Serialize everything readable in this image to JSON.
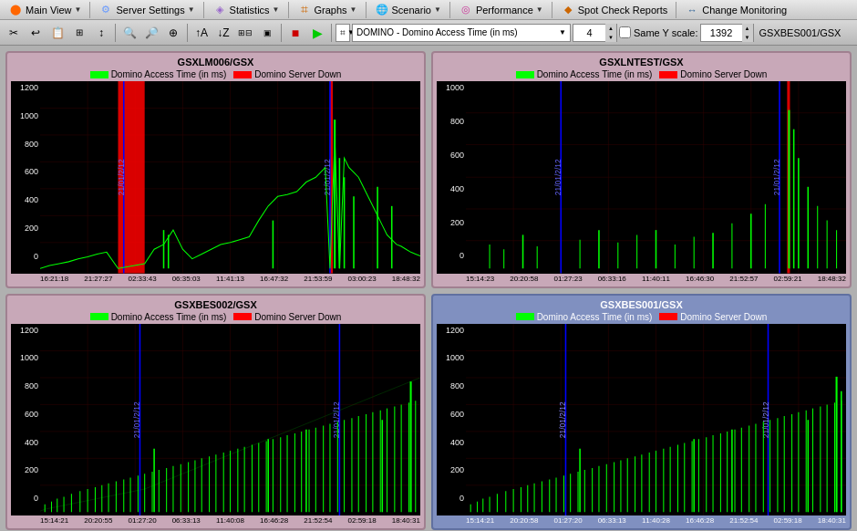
{
  "menubar": {
    "items": [
      {
        "label": "Main View",
        "icon": "⬤",
        "icon_color": "#ff6600",
        "has_arrow": true
      },
      {
        "label": "Server Settings",
        "icon": "⚙",
        "icon_color": "#6699ff",
        "has_arrow": true
      },
      {
        "label": "Statistics",
        "icon": "◈",
        "icon_color": "#9966cc",
        "has_arrow": true
      },
      {
        "label": "Graphs",
        "icon": "📊",
        "icon_color": "#cc6600",
        "has_arrow": true
      },
      {
        "label": "Scenario",
        "icon": "🌐",
        "icon_color": "#33aacc",
        "has_arrow": true
      },
      {
        "label": "Performance",
        "icon": "◎",
        "icon_color": "#cc3399",
        "has_arrow": true
      },
      {
        "label": "Spot Check Reports",
        "icon": "◆",
        "icon_color": "#cc6600",
        "has_arrow": false
      },
      {
        "label": "Change Monitoring",
        "icon": "↔",
        "icon_color": "#336699",
        "has_arrow": false
      }
    ]
  },
  "toolbar": {
    "dropdown_value": "DOMINO - Domino Access Time (in ms)",
    "number_value": "4",
    "same_y_label": "Same Y scale:",
    "y_value": "1392",
    "server_label": "GSXBES001/GSX"
  },
  "charts": [
    {
      "id": "top-left",
      "title": "GSXLM006/GSX",
      "bg": "pink",
      "legend": [
        {
          "label": "Domino Access Time (in ms)",
          "color": "#00ff00"
        },
        {
          "label": "Domino Server Down",
          "color": "#ff0000"
        }
      ],
      "y_labels": [
        "1200",
        "1000",
        "800",
        "600",
        "400",
        "200",
        "0"
      ],
      "x_labels": [
        "16:21:18",
        "21:27:27",
        "02:33:43",
        "06:35:03",
        "11:41:13",
        "16:47:32",
        "21:53:59",
        "03:00:23",
        "18:48:32"
      ],
      "has_red_block": true,
      "red_block_pos": 0.22,
      "red_block_width": 0.08,
      "has_red_spike": true,
      "red_spike_pos": 0.77
    },
    {
      "id": "top-right",
      "title": "GSXLNTEST/GSX",
      "bg": "pink",
      "legend": [
        {
          "label": "Domino Access Time (in ms)",
          "color": "#00ff00"
        },
        {
          "label": "Domino Server Down",
          "color": "#ff0000"
        }
      ],
      "y_labels": [
        "1000",
        "800",
        "600",
        "400",
        "200",
        "0"
      ],
      "x_labels": [
        "15:14:23",
        "20:20:58",
        "01:27:23",
        "06:33:16",
        "11:40:11",
        "16:46:30",
        "21:52:57",
        "02:59:21",
        "18:48:32"
      ],
      "has_red_block": false,
      "has_red_spike": true,
      "red_spike_pos": 0.85
    },
    {
      "id": "bottom-left",
      "title": "GSXBES002/GSX",
      "bg": "pink",
      "legend": [
        {
          "label": "Domino Access Time (in ms)",
          "color": "#00ff00"
        },
        {
          "label": "Domino Server Down",
          "color": "#ff0000"
        }
      ],
      "y_labels": [
        "1200",
        "1000",
        "800",
        "600",
        "400",
        "200",
        "0"
      ],
      "x_labels": [
        "15:14:21",
        "20:20:55",
        "01:27:20",
        "06:33:13",
        "11:40:08",
        "16:46:28",
        "21:52:54",
        "02:59:18",
        "18:40:31"
      ],
      "has_red_block": false,
      "has_red_spike": false
    },
    {
      "id": "bottom-right",
      "title": "GSXBES001/GSX",
      "bg": "blue",
      "legend": [
        {
          "label": "Domino Access Time (in ms)",
          "color": "#00ff00"
        },
        {
          "label": "Domino Server Down",
          "color": "#ff0000"
        }
      ],
      "y_labels": [
        "1200",
        "1000",
        "800",
        "600",
        "400",
        "200",
        "0"
      ],
      "x_labels": [
        "15:14:21",
        "20:20:58",
        "01:27:20",
        "06:33:13",
        "11:40:28",
        "16:46:28",
        "21:52:54",
        "02:59:18",
        "18:40:31"
      ],
      "has_red_block": false,
      "has_red_spike": false
    }
  ]
}
